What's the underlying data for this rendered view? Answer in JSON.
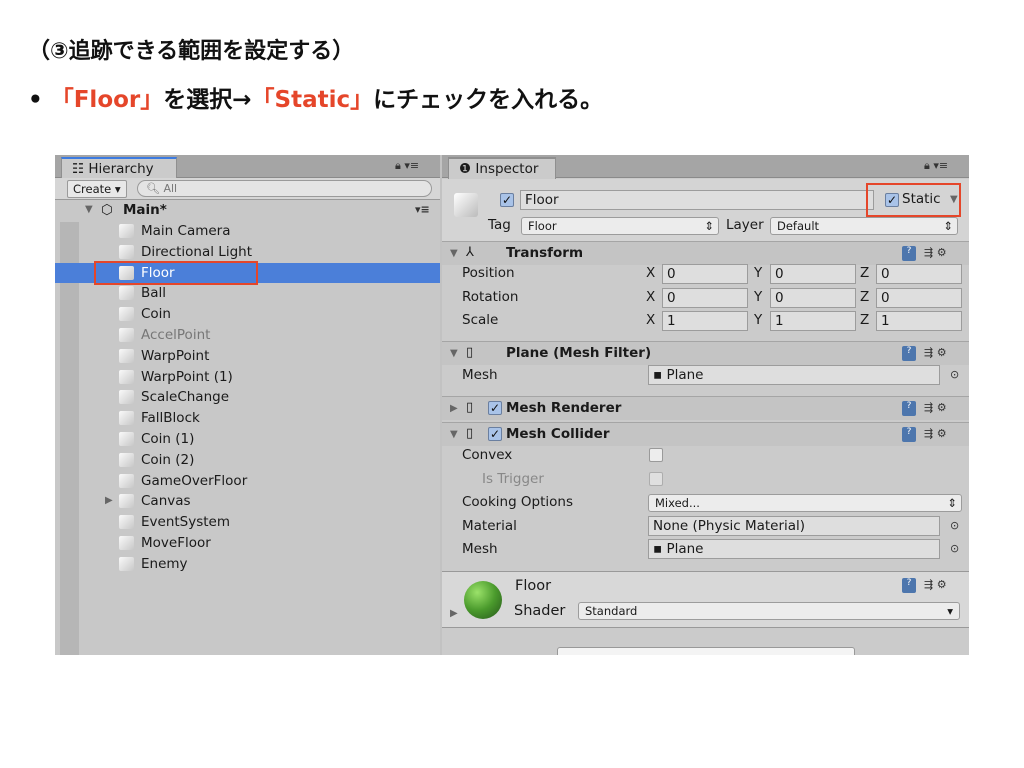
{
  "slide": {
    "title": "（③追跡できる範囲を設定する）",
    "bullet": "•",
    "q1": "「Floor」",
    "t1": "を選択→",
    "q2": "「Static」",
    "t2": "にチェックを入れる。",
    "accent": "#e5462a"
  },
  "hierarchy": {
    "tab": "Hierarchy",
    "create": "Create ▾",
    "search_placeholder": "All",
    "scene": "Main*",
    "items": [
      "Main Camera",
      "Directional Light",
      "Floor",
      "Ball",
      "Coin",
      "AccelPoint",
      "WarpPoint",
      "WarpPoint (1)",
      "ScaleChange",
      "FallBlock",
      "Coin (1)",
      "Coin (2)",
      "GameOverFloor",
      "Canvas",
      "EventSystem",
      "MoveFloor",
      "Enemy"
    ],
    "selected": "Floor"
  },
  "inspector": {
    "tab": "Inspector",
    "name": "Floor",
    "static_label": "Static",
    "static_checked": true,
    "tag_label": "Tag",
    "tag": "Floor",
    "layer_label": "Layer",
    "layer": "Default",
    "transform": {
      "title": "Transform",
      "rows": [
        {
          "label": "Position",
          "x": "0",
          "y": "0",
          "z": "0"
        },
        {
          "label": "Rotation",
          "x": "0",
          "y": "0",
          "z": "0"
        },
        {
          "label": "Scale",
          "x": "1",
          "y": "1",
          "z": "1"
        }
      ]
    },
    "mesh_filter": {
      "title": "Plane (Mesh Filter)",
      "mesh_label": "Mesh",
      "mesh": "Plane"
    },
    "mesh_renderer": {
      "title": "Mesh Renderer"
    },
    "mesh_collider": {
      "title": "Mesh Collider",
      "convex": "Convex",
      "is_trigger": "Is Trigger",
      "cooking_label": "Cooking Options",
      "cooking": "Mixed...",
      "material_label": "Material",
      "material": "None (Physic Material)",
      "mesh_label": "Mesh",
      "mesh": "Plane"
    },
    "material": {
      "name": "Floor",
      "shader_label": "Shader",
      "shader": "Standard"
    }
  }
}
